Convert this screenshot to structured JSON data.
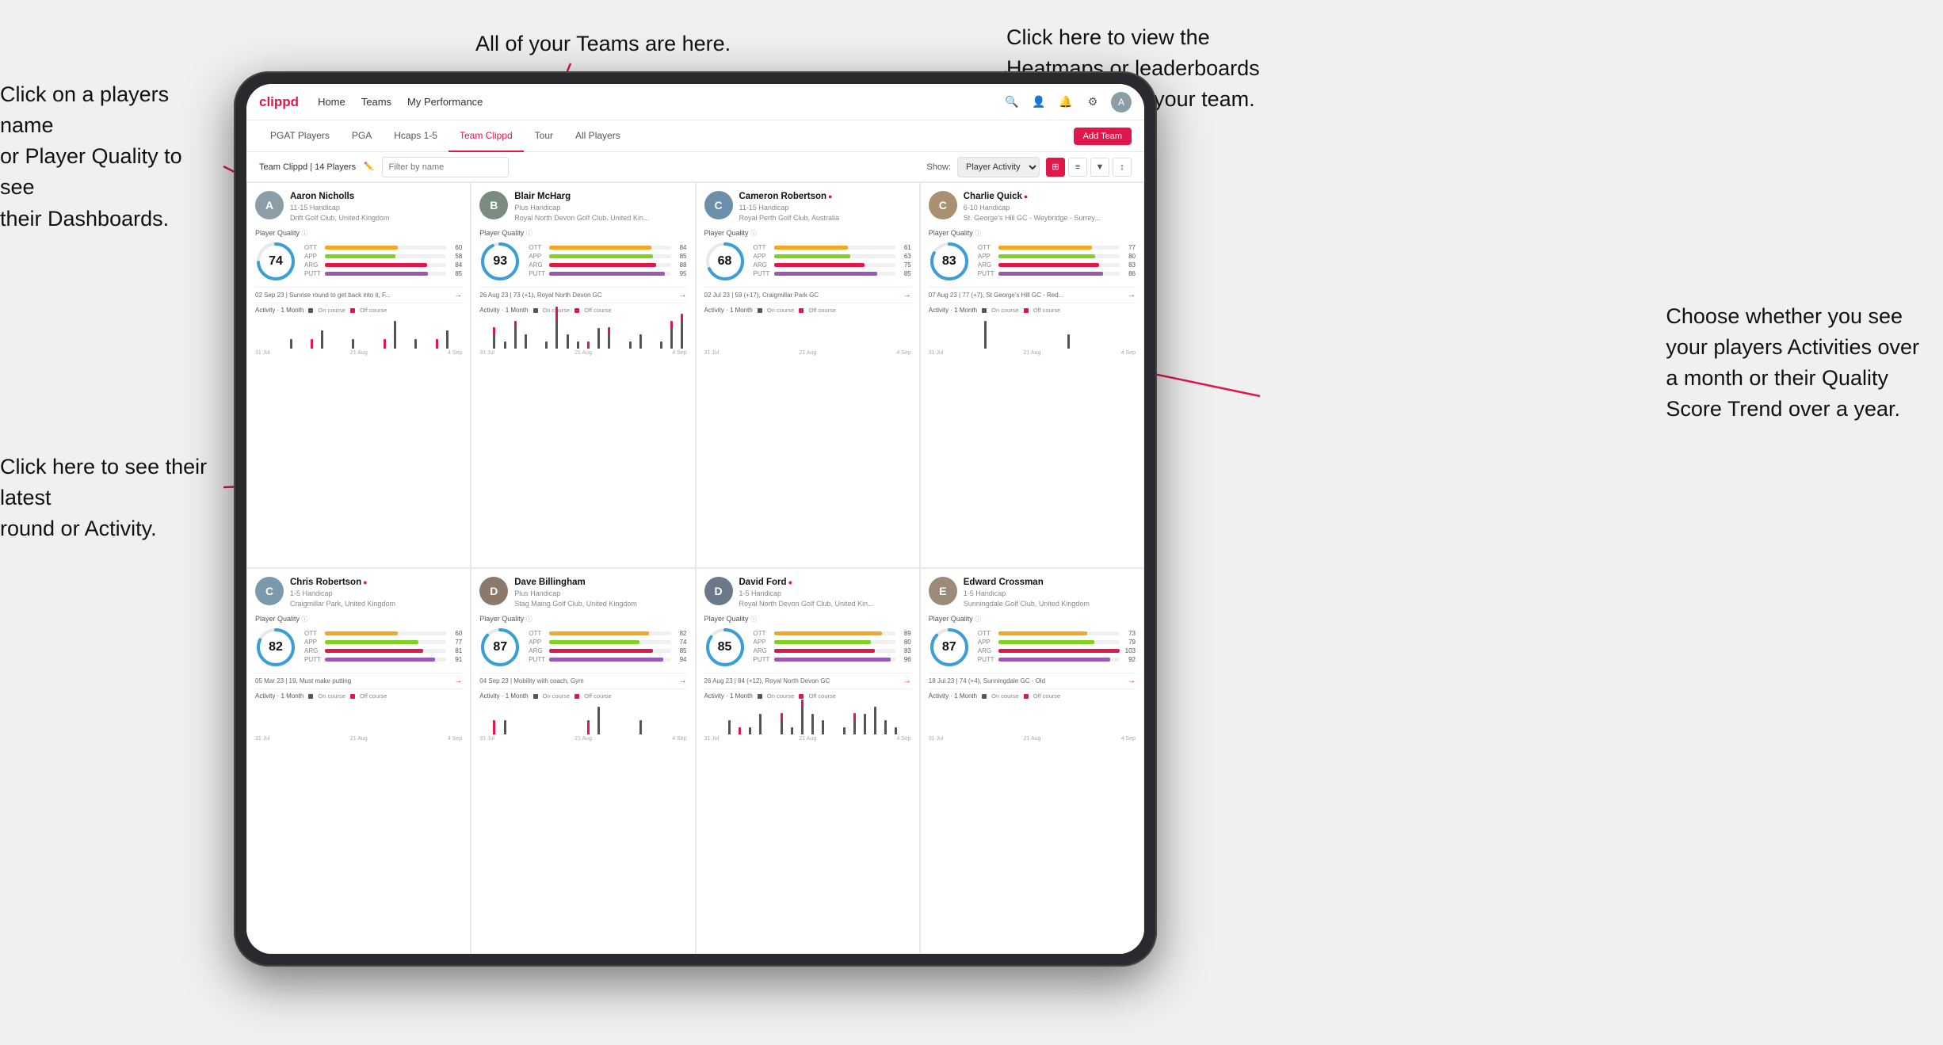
{
  "annotations": {
    "top_center": "All of your Teams are here.",
    "top_right_line1": "Click here to view the",
    "top_right_line2": "Heatmaps or leaderboards",
    "top_right_line3": "and streaks for your team.",
    "left_top_line1": "Click on a players name",
    "left_top_line2": "or Player Quality to see",
    "left_top_line3": "their Dashboards.",
    "left_bottom_line1": "Click here to see their latest",
    "left_bottom_line2": "round or Activity.",
    "right_bottom_line1": "Choose whether you see",
    "right_bottom_line2": "your players Activities over",
    "right_bottom_line3": "a month or their Quality",
    "right_bottom_line4": "Score Trend over a year."
  },
  "nav": {
    "logo": "clippd",
    "items": [
      "Home",
      "Teams",
      "My Performance"
    ],
    "add_team": "Add Team"
  },
  "sub_nav": {
    "tabs": [
      "PGAT Players",
      "PGA",
      "Hcaps 1-5",
      "Team Clippd",
      "Tour",
      "All Players"
    ]
  },
  "filter_bar": {
    "team_label": "Team Clippd | 14 Players",
    "search_placeholder": "Filter by name",
    "show_label": "Show:",
    "show_options": [
      "Player Activity"
    ]
  },
  "players": [
    {
      "name": "Aaron Nicholls",
      "handicap": "11-15 Handicap",
      "club": "Drift Golf Club, United Kingdom",
      "quality": 74,
      "color": "#3a9fd5",
      "ott": 60,
      "app": 58,
      "arg": 84,
      "putt": 85,
      "latest_round": "02 Sep 23 | Sunrise round to get back into it, F...",
      "avatar_color": "#8B9EA8",
      "avatar_letter": "A"
    },
    {
      "name": "Blair McHarg",
      "handicap": "Plus Handicap",
      "club": "Royal North Devon Golf Club, United Kin...",
      "quality": 93,
      "color": "#3a9fd5",
      "ott": 84,
      "app": 85,
      "arg": 88,
      "putt": 95,
      "latest_round": "26 Aug 23 | 73 (+1), Royal North Devon GC",
      "avatar_color": "#7A8B7F",
      "avatar_letter": "B"
    },
    {
      "name": "Cameron Robertson",
      "handicap": "11-15 Handicap",
      "club": "Royal Perth Golf Club, Australia",
      "quality": 68,
      "color": "#3a9fd5",
      "ott": 61,
      "app": 63,
      "arg": 75,
      "putt": 85,
      "latest_round": "02 Jul 23 | 59 (+17), Craigmillar Park GC",
      "avatar_color": "#6B8FAB",
      "avatar_letter": "C"
    },
    {
      "name": "Charlie Quick",
      "handicap": "6-10 Handicap",
      "club": "St. George's Hill GC - Weybridge - Surrey...",
      "quality": 83,
      "color": "#3a9fd5",
      "ott": 77,
      "app": 80,
      "arg": 83,
      "putt": 86,
      "latest_round": "07 Aug 23 | 77 (+7), St George's Hill GC - Red...",
      "avatar_color": "#A89070",
      "avatar_letter": "C"
    },
    {
      "name": "Chris Robertson",
      "handicap": "1-5 Handicap",
      "club": "Craigmillar Park, United Kingdom",
      "quality": 82,
      "color": "#3a9fd5",
      "ott": 60,
      "app": 77,
      "arg": 81,
      "putt": 91,
      "latest_round": "05 Mar 23 | 19, Must make putting",
      "avatar_color": "#7A9AAB",
      "avatar_letter": "C"
    },
    {
      "name": "Dave Billingham",
      "handicap": "Plus Handicap",
      "club": "Stag Maing Golf Club, United Kingdom",
      "quality": 87,
      "color": "#3a9fd5",
      "ott": 82,
      "app": 74,
      "arg": 85,
      "putt": 94,
      "latest_round": "04 Sep 23 | Mobility with coach, Gym",
      "avatar_color": "#8B7A6B",
      "avatar_letter": "D"
    },
    {
      "name": "David Ford",
      "handicap": "1-5 Handicap",
      "club": "Royal North Devon Golf Club, United Kin...",
      "quality": 85,
      "color": "#3a9fd5",
      "ott": 89,
      "app": 80,
      "arg": 83,
      "putt": 96,
      "latest_round": "26 Aug 23 | 84 (+12), Royal North Devon GC",
      "avatar_color": "#6B7A8B",
      "avatar_letter": "D"
    },
    {
      "name": "Edward Crossman",
      "handicap": "1-5 Handicap",
      "club": "Sunningdale Golf Club, United Kingdom",
      "quality": 87,
      "color": "#3a9fd5",
      "ott": 73,
      "app": 79,
      "arg": 103,
      "putt": 92,
      "latest_round": "18 Jul 23 | 74 (+4), Sunningdale GC - Old",
      "avatar_color": "#9B8A7A",
      "avatar_letter": "E"
    }
  ],
  "chart_data": {
    "dates": [
      "31 Jul",
      "21 Aug",
      "4 Sep"
    ],
    "colors": {
      "on_course": "#555",
      "off_course": "#e0174a"
    }
  },
  "bar_colors": {
    "ott": "#f5a623",
    "app": "#7ed321",
    "arg": "#e0174a",
    "putt": "#9b59b6"
  }
}
